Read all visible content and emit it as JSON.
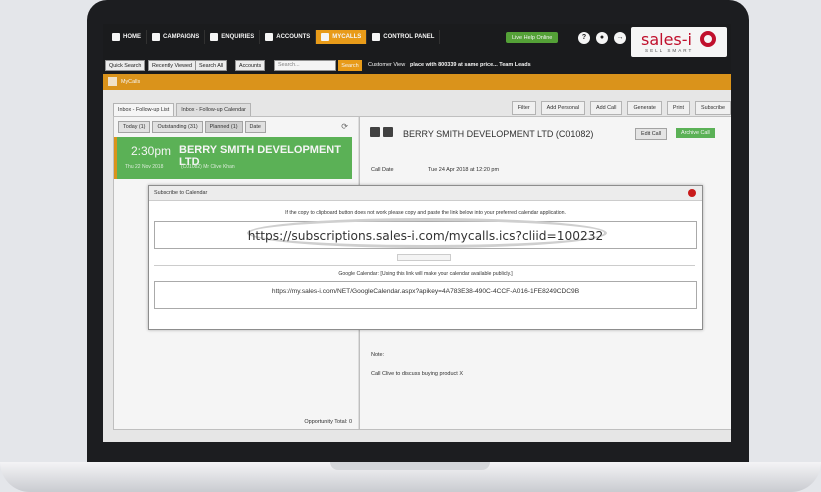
{
  "nav": {
    "items": [
      {
        "label": "HOME",
        "icon": "home-icon"
      },
      {
        "label": "CAMPAIGNS",
        "icon": "campaigns-icon"
      },
      {
        "label": "ENQUIRIES",
        "icon": "enquiries-icon"
      },
      {
        "label": "ACCOUNTS",
        "icon": "accounts-icon"
      },
      {
        "label": "MYCALLS",
        "icon": "mycalls-icon",
        "active": true
      },
      {
        "label": "CONTROL PANEL",
        "icon": "control-panel-icon"
      }
    ],
    "live_help": "Live Help Online",
    "help_glyph": "?"
  },
  "logo": {
    "text": "sales-i",
    "tagline": "SELL SMART"
  },
  "search": {
    "quick_search": "Quick Search",
    "recently_viewed": "Recently Viewed",
    "search_all": "Search All",
    "accounts": "Accounts",
    "placeholder": "Search...",
    "button": "Search",
    "customer_view": "Customer View",
    "ticker": "place with 800339 at same price... Team Leads"
  },
  "page": {
    "section": "MyCalls"
  },
  "tabs": [
    "Inbox - Follow-up List",
    "Inbox - Follow-up Calendar"
  ],
  "toolbar": [
    "Filter",
    "Add Personal",
    "Add Call",
    "Generate",
    "Print",
    "Subscribe"
  ],
  "filters": [
    "Today (1)",
    "Outstanding (31)",
    "Planned (1)",
    "Date"
  ],
  "call_item": {
    "time": "2:30pm",
    "company": "BERRY SMITH DEVELOPMENT LTD",
    "date": "Thu 22 Nov 2018",
    "ref": "(C01082)   Mr Clive Khan"
  },
  "opportunity_total": "Opportunity Total: 0",
  "detail": {
    "title": "BERRY SMITH DEVELOPMENT LTD (C01082)",
    "edit": "Edit Call",
    "archive": "Archive Call",
    "call_date_label": "Call Date",
    "call_date_value": "Tue 24 Apr 2018 at 12:20 pm",
    "note_label": "Note:",
    "note_value": "Call Clive to discuss buying product X"
  },
  "modal": {
    "title": "Subscribe to Calendar",
    "instruction": "If the copy to clipboard button does not work please copy and paste the link below into your preferred calendar application.",
    "ics_url": "https://subscriptions.sales-i.com/mycalls.ics?cliid=100232",
    "google_note": "Google Calendar: [Using this link will make your calendar available publicly.]",
    "google_url": "https://my.sales-i.com/NET/GoogleCalendar.aspx?apikey=4A783E38-490C-4CCF-A016-1FE8249CDC9B"
  }
}
